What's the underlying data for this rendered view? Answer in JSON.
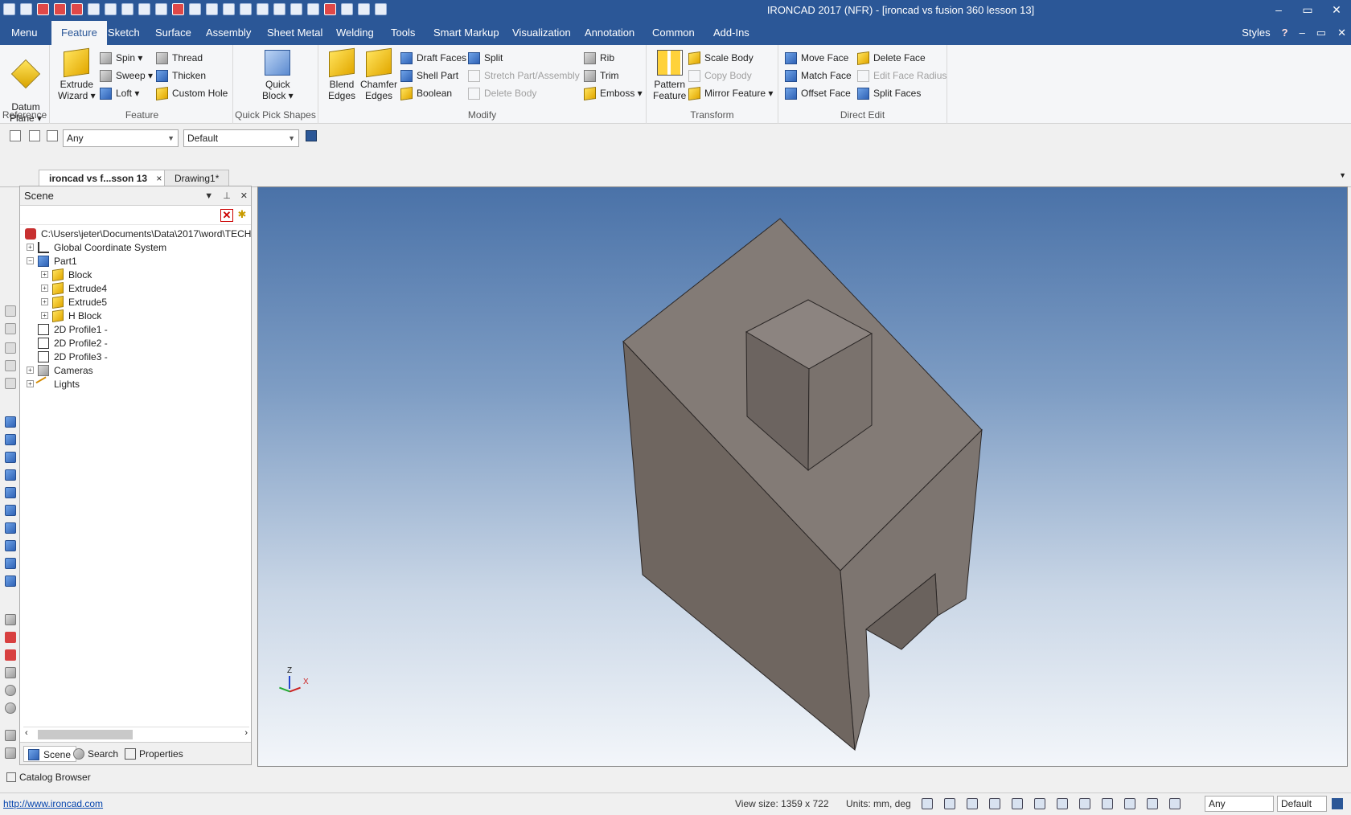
{
  "title": "IRONCAD 2017 (NFR) - [ironcad vs fusion 360 lesson 13]",
  "window_controls": [
    "–",
    "▭",
    "✕"
  ],
  "menu_tabs": [
    "Menu",
    "Feature",
    "Sketch",
    "Surface",
    "Assembly",
    "Sheet Metal",
    "Welding",
    "Tools",
    "Smart Markup",
    "Visualization",
    "Annotation",
    "Common",
    "Add-Ins"
  ],
  "menu_right": {
    "styles": "Styles",
    "help": "?",
    "controls": [
      "–",
      "▭",
      "✕"
    ]
  },
  "ribbon": {
    "reference": {
      "label": "Reference",
      "datum_plane": "Datum\nPlane ▾"
    },
    "feature": {
      "label": "Feature",
      "extrude_wizard": "Extrude\nWizard ▾",
      "spin": "Spin ▾",
      "sweep": "Sweep ▾",
      "loft": "Loft ▾",
      "thread": "Thread",
      "thicken": "Thicken",
      "custom_hole": "Custom Hole"
    },
    "quick_pick": {
      "label": "Quick Pick Shapes",
      "quick_block": "Quick\nBlock ▾"
    },
    "modify": {
      "label": "Modify",
      "blend_edges": "Blend\nEdges",
      "chamfer_edges": "Chamfer\nEdges",
      "draft_faces": "Draft Faces",
      "shell_part": "Shell Part",
      "boolean": "Boolean",
      "split": "Split",
      "stretch": "Stretch Part/Assembly",
      "delete_body": "Delete Body",
      "rib": "Rib",
      "trim": "Trim",
      "emboss": "Emboss ▾"
    },
    "transform": {
      "label": "Transform",
      "pattern_feature": "Pattern\nFeature",
      "scale_body": "Scale Body",
      "copy_body": "Copy Body",
      "mirror_feature": "Mirror Feature ▾"
    },
    "direct_edit": {
      "label": "Direct Edit",
      "move_face": "Move Face",
      "match_face": "Match Face",
      "offset_face": "Offset Face",
      "delete_face": "Delete Face",
      "edit_face_radius": "Edit Face Radius",
      "split_faces": "Split Faces"
    }
  },
  "selection_bar": {
    "filter": "Any",
    "style": "Default"
  },
  "doc_tabs": [
    {
      "label": "ironcad vs f...sson 13",
      "close": "×"
    },
    {
      "label": "Drawing1*"
    }
  ],
  "scene_panel": {
    "title": "Scene",
    "tree": [
      {
        "label": "C:\\Users\\jeter\\Documents\\Data\\2017\\word\\TECH",
        "level": 0
      },
      {
        "label": "Global Coordinate System",
        "level": 1
      },
      {
        "label": "Part1",
        "level": 1
      },
      {
        "label": "Block",
        "level": 2
      },
      {
        "label": "Extrude4",
        "level": 2
      },
      {
        "label": "Extrude5",
        "level": 2
      },
      {
        "label": "H Block",
        "level": 2
      },
      {
        "label": "2D Profile1 -",
        "level": 1
      },
      {
        "label": "2D Profile2 -",
        "level": 1
      },
      {
        "label": "2D Profile3 -",
        "level": 1
      },
      {
        "label": "Cameras",
        "level": 1
      },
      {
        "label": "Lights",
        "level": 1
      }
    ],
    "tabs": [
      "Scene",
      "Search",
      "Properties"
    ]
  },
  "catalog_browser": "Catalog Browser",
  "axis_triad": {
    "z": "Z",
    "x": "X"
  },
  "status": {
    "link": "http://www.ironcad.com",
    "view_size": "View size: 1359 x  722",
    "units": "Units: mm, deg",
    "filter": "Any",
    "style": "Default"
  },
  "colors": {
    "title_bar": "#2b5797",
    "viewport_top": "#4a72a8",
    "viewport_bottom": "#f3f6fa",
    "model": "#7f7671"
  }
}
